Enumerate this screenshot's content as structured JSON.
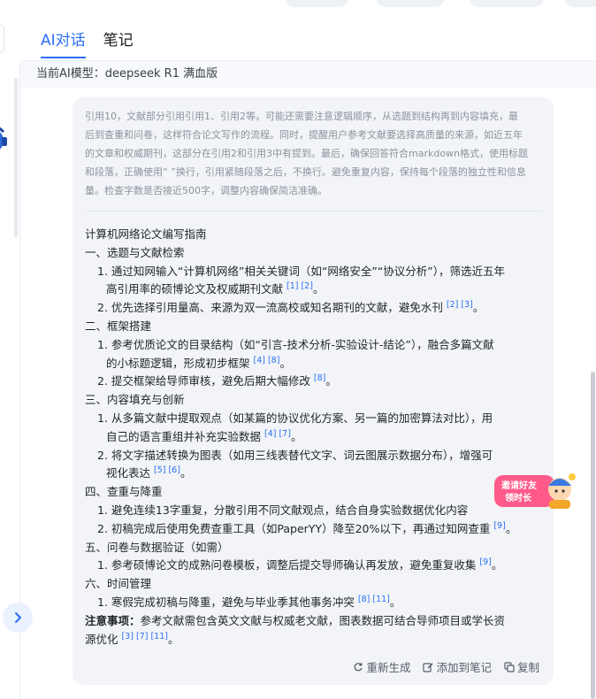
{
  "tabs": [
    {
      "label": "AI对话"
    },
    {
      "label": "笔记"
    }
  ],
  "model": {
    "label": "当前AI模型：deepseek R1 满血版"
  },
  "thinking": {
    "lines": [
      "引用10，文献部分引用引用1、引用2等。可能还需要注意逻辑顺序，从选题到结构再到内容填充，最",
      "后到查重和问卷，这样符合论文写作的流程。同时，提醒用户参考文献要选择高质量的来源，如近五年",
      "的文章和权威期刊，这部分在引用2和引用3中有提到。最后，确保回答符合markdown格式，使用标题",
      "和段落，正确使用“ ”换行，引用紧随段落之后，不换行。避免重复内容，保持每个段落的独立性和信息",
      "量。检查字数是否接近500字，调整内容确保简洁准确。"
    ]
  },
  "answer": {
    "title": "计算机网络论文编写指南",
    "s1": "一、选题与文献检索",
    "s1_i1a": "1. 通过知网输入“计算机网络”相关关键词（如“网络安全”“协议分析”），筛选近五年",
    "s1_i1b": "高引用率的硕博论文及权威期刊文献",
    "s1_i1_c": "[1] [2]",
    "s1_i2": "2. 优先选择引用量高、来源为双一流高校或知名期刊的文献，避免水刊",
    "s1_i2_c": "[2] [3]",
    "s2": "二、框架搭建",
    "s2_i1a": "1. 参考优质论文的目录结构（如“引言-技术分析-实验设计-结论”），融合多篇文献",
    "s2_i1b": "的小标题逻辑，形成初步框架",
    "s2_i1_c": "[4] [8]",
    "s2_i2": "2. 提交框架给导师审核，避免后期大幅修改",
    "s2_i2_c": "[8]",
    "s3": "三、内容填充与创新",
    "s3_i1a": "1. 从多篇文献中提取观点（如某篇的协议优化方案、另一篇的加密算法对比），用",
    "s3_i1b": "自己的语言重组并补充实验数据",
    "s3_i1_c": "[4] [7]",
    "s3_i2a": "2. 将文字描述转换为图表（如用三线表替代文字、词云图展示数据分布），增强可",
    "s3_i2b": "视化表达",
    "s3_i2_c": "[5] [6]",
    "s4": "四、查重与降重",
    "s4_i1": "1. 避免连续13字重复，分散引用不同文献观点，结合自身实验数据优化内容",
    "s4_i2": "2. 初稿完成后使用免费查重工具（如PaperYY）降至20%以下，再通过知网查重",
    "s4_i2_c": "[9]",
    "s5": "五、问卷与数据验证（如需）",
    "s5_i1": "1. 参考硕博论文的成熟问卷模板，调整后提交导师确认再发放，避免重复收集",
    "s5_i1_c": "[9]",
    "s6": "六、时间管理",
    "s6_i1": "1. 寒假完成初稿与降重，避免与毕业季其他事务冲突",
    "s6_i1_c": "[8] [11]",
    "note_label": "注意事项：",
    "note_a": "参考文献需包含英文文献与权威老文献，图表数据可结合导师项目或学长资",
    "note_b": "源优化",
    "note_c": "[3] [7] [11]"
  },
  "actions": {
    "regenerate": "重新生成",
    "add_note": "添加到笔记",
    "copy": "复制"
  },
  "promo": {
    "line1": "邀请好友",
    "line2": "领时长"
  }
}
